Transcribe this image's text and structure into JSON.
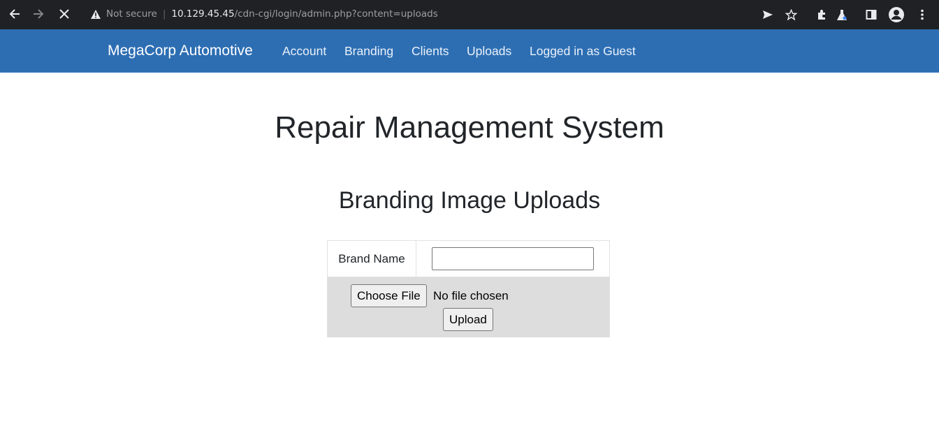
{
  "browser": {
    "security_label": "Not secure",
    "url_host": "10.129.45.45",
    "url_path": "/cdn-cgi/login/admin.php?content=uploads",
    "icons": [
      "back-arrow-icon",
      "forward-arrow-icon",
      "stop-icon",
      "warning-icon",
      "share-icon",
      "star-icon",
      "extensions-icon",
      "labs-icon",
      "side-panel-icon",
      "profile-icon",
      "menu-icon"
    ]
  },
  "navbar": {
    "brand": "MegaCorp Automotive",
    "items": [
      "Account",
      "Branding",
      "Clients",
      "Uploads",
      "Logged in as Guest"
    ],
    "color": "#2d6eb3"
  },
  "main": {
    "title": "Repair Management System",
    "section_title": "Branding Image Uploads",
    "form": {
      "brand_label": "Brand Name",
      "brand_value": "",
      "choose_file_label": "Choose File",
      "file_status": "No file chosen",
      "upload_label": "Upload"
    }
  }
}
